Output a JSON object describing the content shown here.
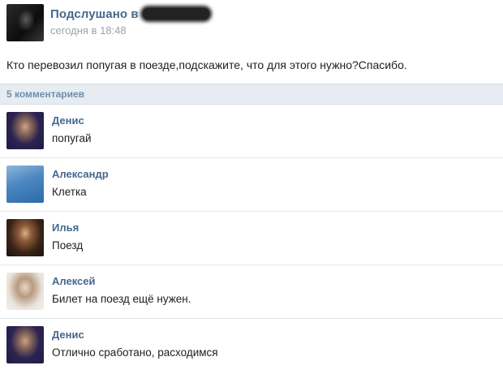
{
  "post": {
    "group_name": "Подслушано в",
    "time": "сегодня в 18:48",
    "text": "Кто перевозил попугая в поезде,подскажите, что для этого нужно?Спасибо."
  },
  "comments_header": "5 комментариев",
  "comments": [
    {
      "author": "Денис",
      "text": "попугай"
    },
    {
      "author": "Александр",
      "text": "Клетка"
    },
    {
      "author": "Илья",
      "text": "Поезд"
    },
    {
      "author": "Алексей",
      "text": "Билет на поезд ещё нужен."
    },
    {
      "author": "Денис",
      "text": "Отлично сработано, расходимся"
    }
  ]
}
